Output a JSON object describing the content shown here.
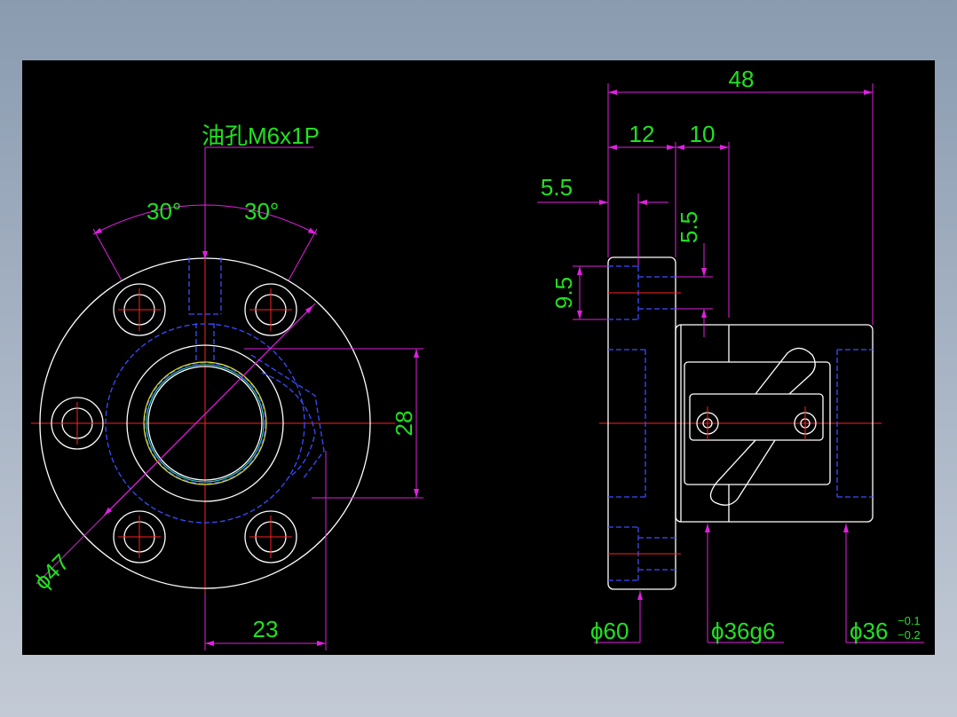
{
  "colors": {
    "background": "#000000",
    "dimension_text": "#22e022",
    "dimension_line": "#e020e0",
    "outline": "#ffffff",
    "center_line": "#ff2020",
    "hidden_line": "#3a4cff"
  },
  "front_view": {
    "oil_hole_label": "油孔M6x1P",
    "angle_left": "30°",
    "angle_right": "30°",
    "dim_height": "28",
    "dim_pcd": "ϕ47",
    "dim_offset": "23"
  },
  "side_view": {
    "dim_total_length": "48",
    "dim_flange_width": "12",
    "dim_step": "10",
    "dim_hole_offset_h": "5.5",
    "dim_hole_offset_v": "5.5",
    "dim_hole_dia": "9.5",
    "dim_flange_dia": "ϕ60",
    "dim_body_dia": "ϕ36g6",
    "dim_end_dia": "ϕ36",
    "tol_upper": "−0.1",
    "tol_lower": "−0.2"
  }
}
